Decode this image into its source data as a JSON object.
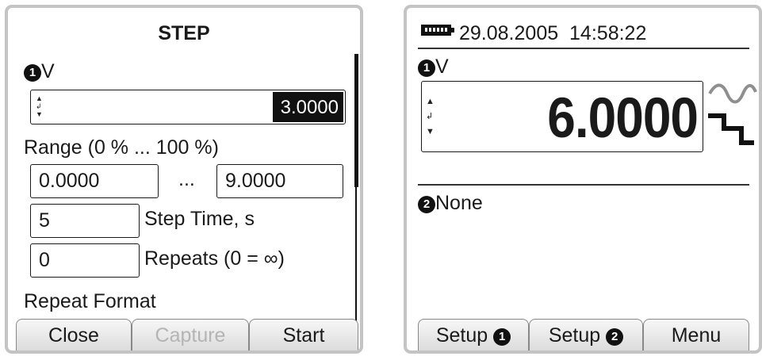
{
  "left": {
    "title": "STEP",
    "channel_marker": "1",
    "channel_unit": "V",
    "value": "3.0000",
    "range_label": "Range (0 % ... 100 %)",
    "range_min": "0.0000",
    "range_sep": "...",
    "range_max": "9.0000",
    "step_time_value": "5",
    "step_time_label": "Step Time, s",
    "repeats_value": "0",
    "repeats_label": "Repeats (0 = ∞)",
    "repeat_format_label": "Repeat Format",
    "tabs": {
      "close": "Close",
      "capture": "Capture",
      "start": "Start"
    }
  },
  "right": {
    "date": "29.08.2005",
    "time": "14:58:22",
    "channel1_marker": "1",
    "channel1_unit": "V",
    "big_value": "6.0000",
    "channel2_marker": "2",
    "channel2_label": "None",
    "tabs": {
      "setup1": "Setup",
      "setup2": "Setup",
      "menu": "Menu"
    },
    "tab_markers": {
      "setup1": "1",
      "setup2": "2"
    }
  },
  "icons": {
    "battery": "battery-icon",
    "wave": "sine-wave-icon",
    "step": "step-function-icon",
    "arrows": "up-enter-down-icon"
  },
  "colors": {
    "frame": "#c4c4c4",
    "wave": "#8f8f8f",
    "disabled_text": "#b4b4b4",
    "selection": "#111111"
  }
}
